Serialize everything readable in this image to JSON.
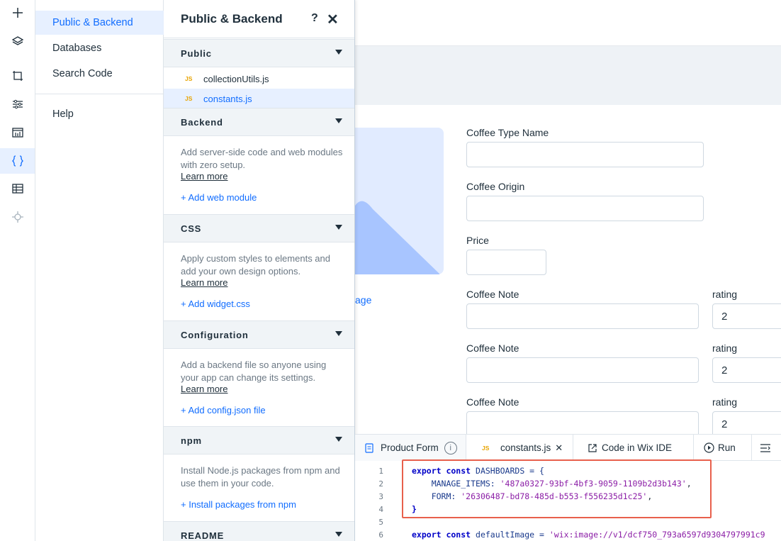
{
  "rail": {
    "icons": [
      "plus-icon",
      "layers-icon",
      "crop-icon",
      "sliders-icon",
      "dashboard-icon",
      "code-braces-icon",
      "table-icon",
      "plugin-icon"
    ]
  },
  "menu": {
    "items": [
      {
        "label": "Public & Backend"
      },
      {
        "label": "Databases"
      },
      {
        "label": "Search Code"
      },
      {
        "label": "Help"
      }
    ]
  },
  "panel": {
    "title": "Public & Backend",
    "help": "?",
    "close": "✕",
    "public": {
      "heading": "Public",
      "files": [
        {
          "badge": "JS",
          "name": "collectionUtils.js"
        },
        {
          "badge": "JS",
          "name": "constants.js"
        }
      ]
    },
    "backend": {
      "heading": "Backend",
      "description": "Add server-side code and web modules with zero setup.",
      "learn": "Learn more",
      "add": "+ Add web module"
    },
    "css": {
      "heading": "CSS",
      "description": "Apply custom styles to elements and add your own design options.",
      "learn": "Learn more",
      "add": "+ Add widget.css"
    },
    "configuration": {
      "heading": "Configuration",
      "description": "Add a backend file so anyone using your app can change its settings.",
      "learn": "Learn more",
      "add": "+ Add config.json file"
    },
    "npm": {
      "heading": "npm",
      "description": "Install Node.js packages from npm and use them in your code.",
      "add": "+ Install packages from npm"
    },
    "readme": {
      "heading": "README"
    }
  },
  "form": {
    "image_link": "age",
    "coffee_type_name": {
      "label": "Coffee Type Name",
      "value": ""
    },
    "coffee_origin": {
      "label": "Coffee Origin",
      "value": ""
    },
    "price": {
      "label": "Price",
      "value": ""
    },
    "notes": [
      {
        "label": "Coffee Note",
        "value": "",
        "rating_label": "rating",
        "rating": "2"
      },
      {
        "label": "Coffee Note",
        "value": "",
        "rating_label": "rating",
        "rating": "2"
      },
      {
        "label": "Coffee Note",
        "value": "",
        "rating_label": "rating",
        "rating": "2"
      }
    ]
  },
  "code_panel": {
    "tabs": {
      "product_form": "Product Form",
      "constants_badge": "JS",
      "constants": "constants.js",
      "close": "✕",
      "wix_ide": "Code in Wix IDE",
      "run": "Run"
    },
    "line_numbers": [
      "1",
      "2",
      "3",
      "4",
      "5",
      "6"
    ],
    "lines": {
      "l1_kw": "export const",
      "l1_rest": " DASHBOARDS = {",
      "l2_key": "    MANAGE_ITEMS: ",
      "l2_val": "'487a0327-93bf-4bf3-9059-1109b2d3b143'",
      "l2_end": ",",
      "l3_key": "    FORM: ",
      "l3_val": "'26306487-bd78-485d-b553-f556235d1c25'",
      "l3_end": ",",
      "l4": "}",
      "l6_kw": "export const",
      "l6_rest": " defaultImage = ",
      "l6_val": "'wix:image://v1/dcf750_793a6597d9304797991c9"
    }
  },
  "colors": {
    "accent": "#116dff",
    "active_bg": "#e7f0ff",
    "highlight_border": "#e8604c",
    "js_badge": "#e8a400"
  }
}
